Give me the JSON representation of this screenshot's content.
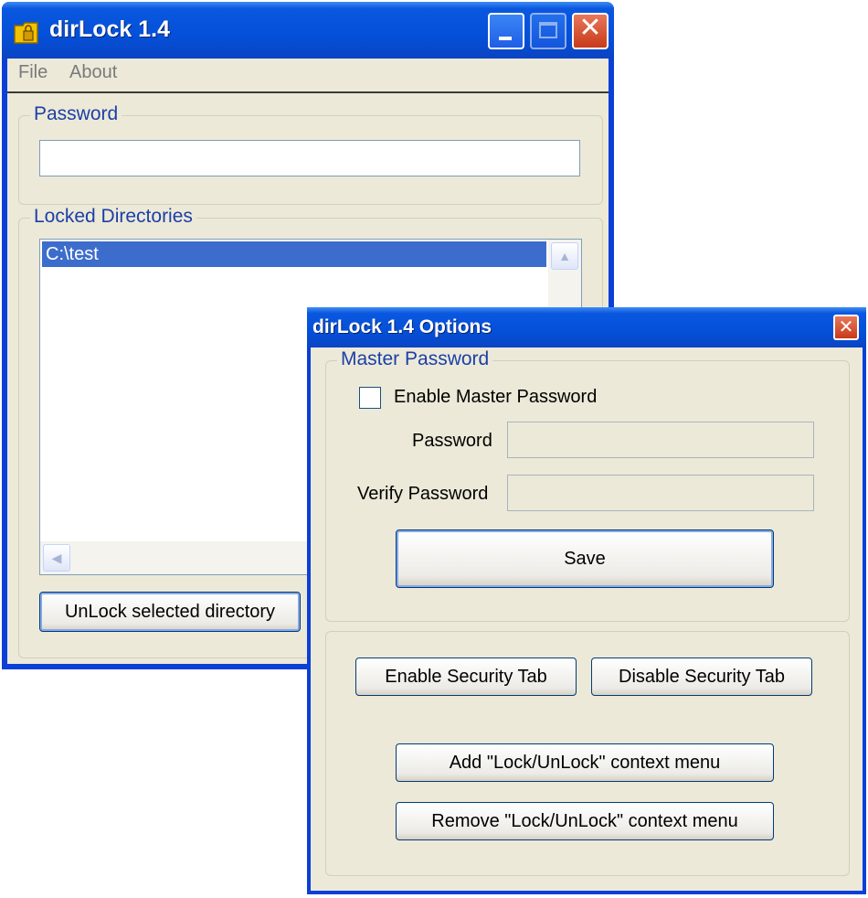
{
  "main_window": {
    "title": "dirLock 1.4",
    "menu": {
      "file": "File",
      "about": "About"
    },
    "password_group": {
      "label": "Password",
      "value": ""
    },
    "locked_group": {
      "label": "Locked Directories",
      "items": [
        "C:\\test"
      ]
    },
    "unlock_button": "UnLock selected directory"
  },
  "options_window": {
    "title": "dirLock 1.4 Options",
    "master_group": {
      "label": "Master Password",
      "enable_checkbox_label": "Enable Master Password",
      "enable_checked": false,
      "password_label": "Password",
      "password_value": "",
      "verify_label": "Verify Password",
      "verify_value": "",
      "save_button": "Save"
    },
    "security": {
      "enable_tab_button": "Enable Security Tab",
      "disable_tab_button": "Disable Security Tab",
      "add_context_button": "Add \"Lock/UnLock\" context menu",
      "remove_context_button": "Remove \"Lock/UnLock\" context menu"
    }
  },
  "colors": {
    "title_bar": "#0450d8",
    "window_face": "#ece9d8",
    "group_label": "#1c3fa8",
    "selection": "#3d6dcc",
    "close_button": "#c83a1a"
  },
  "icons": [
    "folder-lock-icon",
    "minimize-icon",
    "maximize-icon",
    "close-icon",
    "scroll-up-icon",
    "scroll-left-icon"
  ]
}
